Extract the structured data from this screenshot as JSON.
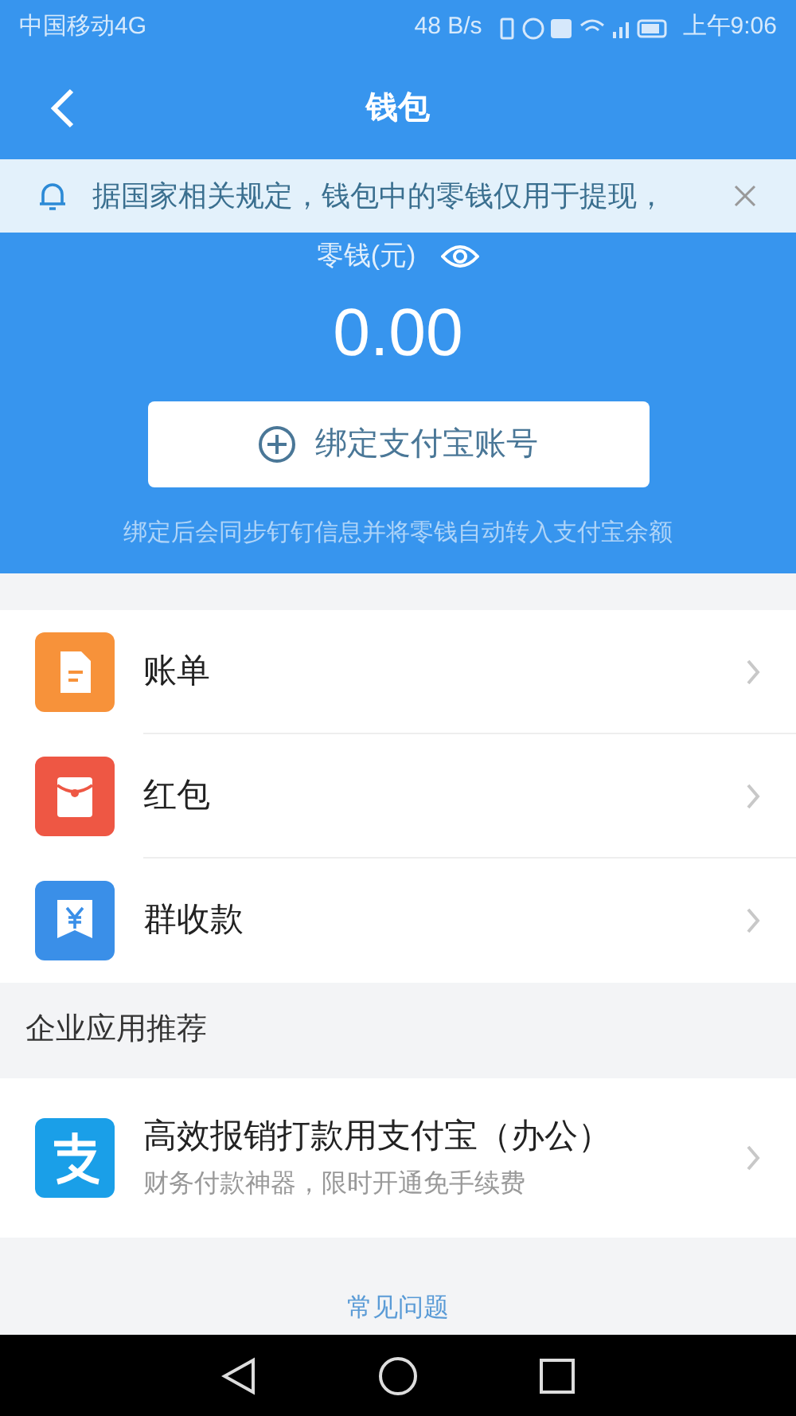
{
  "status_bar": {
    "carrier": "中国移动4G",
    "speed": "48 B/s",
    "time": "上午9:06"
  },
  "header": {
    "title": "钱包"
  },
  "notice": {
    "text": "据国家相关规定，钱包中的零钱仅用于提现，"
  },
  "balance": {
    "label": "零钱(元)",
    "amount": "0.00",
    "bind_button": "绑定支付宝账号",
    "hint": "绑定后会同步钉钉信息并将零钱自动转入支付宝余额"
  },
  "menu": [
    {
      "kind": "bill",
      "label": "账单"
    },
    {
      "kind": "red_packet",
      "label": "红包"
    },
    {
      "kind": "group_collect",
      "label": "群收款"
    }
  ],
  "section_title": "企业应用推荐",
  "apps": [
    {
      "title": "高效报销打款用支付宝（办公）",
      "subtitle": "财务付款神器，限时开通免手续费"
    }
  ],
  "faq_link": "常见问题"
}
